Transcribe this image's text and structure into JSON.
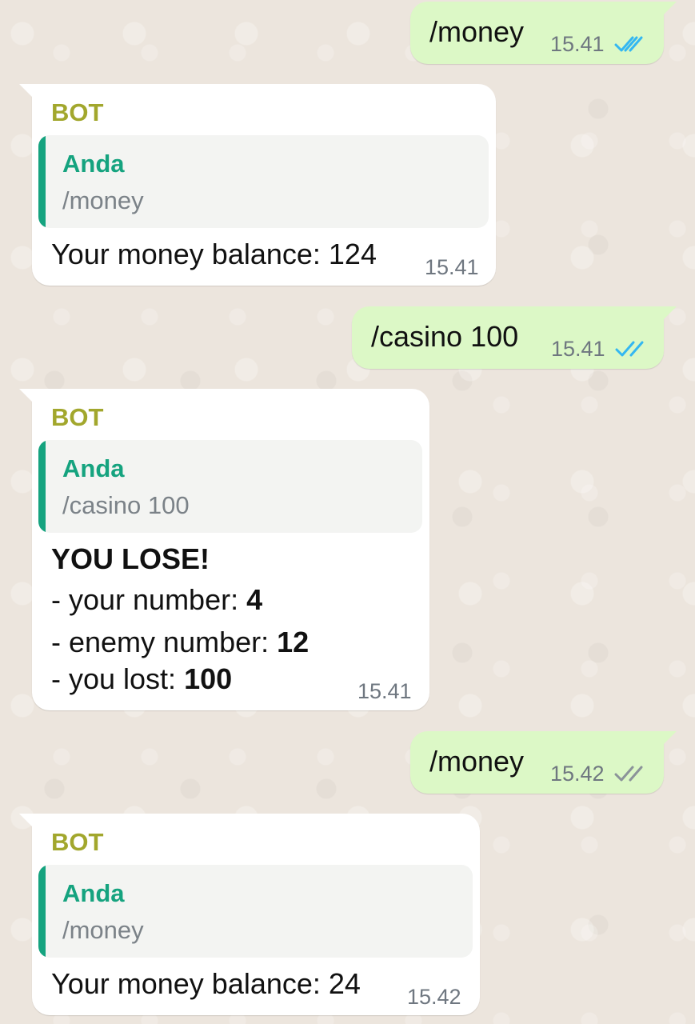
{
  "messages": [
    {
      "direction": "outgoing",
      "text": "/money",
      "time": "15.41",
      "status": "read",
      "tick_color": "#34b7f1"
    },
    {
      "direction": "incoming",
      "sender": "BOT",
      "quote": {
        "author": "Anda",
        "text": "/money"
      },
      "line1": "Your money balance: 124",
      "time": "15.41"
    },
    {
      "direction": "outgoing",
      "text": "/casino 100",
      "time": "15.41",
      "status": "read",
      "tick_color": "#34b7f1"
    },
    {
      "direction": "incoming",
      "sender": "BOT",
      "quote": {
        "author": "Anda",
        "text": "/casino 100"
      },
      "headline": "YOU LOSE!",
      "rows": [
        {
          "label": "- your number: ",
          "value": "4"
        },
        {
          "label": "- enemy number: ",
          "value": "12"
        },
        {
          "label": "- you lost: ",
          "value": "100"
        }
      ],
      "time": "15.41"
    },
    {
      "direction": "outgoing",
      "text": "/money",
      "time": "15.42",
      "status": "delivered",
      "tick_color": "#8b9399"
    },
    {
      "direction": "incoming",
      "sender": "BOT",
      "quote": {
        "author": "Anda",
        "text": "/money"
      },
      "line1": "Your money balance: 24",
      "time": "15.42"
    }
  ],
  "colors": {
    "outgoing_bubble": "#dcf8c6",
    "incoming_bubble": "#ffffff",
    "sender_name": "#a2a72d",
    "quote_accent": "#15a37f",
    "read_ticks": "#34b7f1",
    "delivered_ticks": "#8b9399"
  },
  "icons": {
    "read_receipt": "double-check-icon"
  }
}
